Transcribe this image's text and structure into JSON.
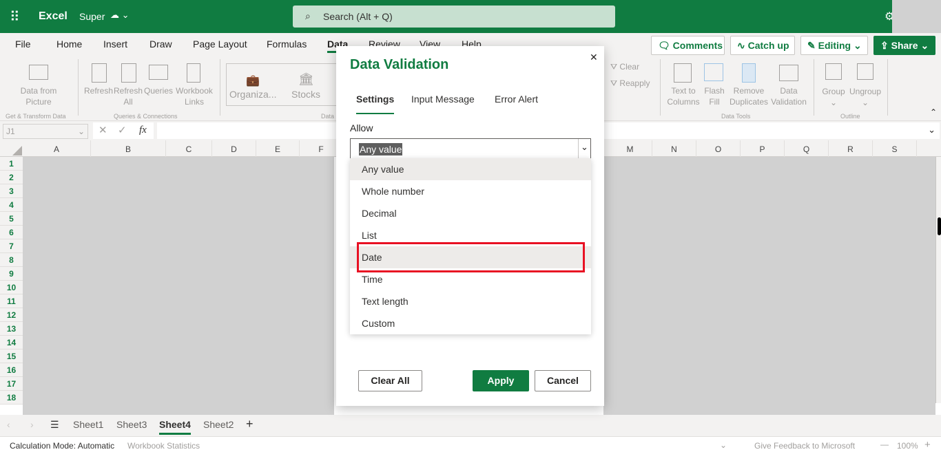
{
  "app": {
    "name": "Excel",
    "file": "Super",
    "search_placeholder": "Search (Alt + Q)"
  },
  "menu": [
    "File",
    "Home",
    "Insert",
    "Draw",
    "Page Layout",
    "Formulas",
    "Data",
    "Review",
    "View",
    "Help"
  ],
  "header_buttons": {
    "comments": "Comments",
    "catchup": "Catch up",
    "editing": "Editing",
    "share": "Share"
  },
  "ribbon": {
    "data_from_picture": [
      "Data from",
      "Picture"
    ],
    "get_transform": "Get & Transform Data",
    "refresh": "Refresh",
    "refresh_all": [
      "Refresh",
      "All"
    ],
    "queries": "Queries",
    "workbook_links": [
      "Workbook",
      "Links"
    ],
    "queries_connections": "Queries & Connections",
    "organization": "Organiza...",
    "stocks": "Stocks",
    "data_types": "Data",
    "clear": "Clear",
    "reapply": "Reapply",
    "text_to_columns": [
      "Text to",
      "Columns"
    ],
    "flash_fill": [
      "Flash",
      "Fill"
    ],
    "remove_duplicates": [
      "Remove",
      "Duplicates"
    ],
    "data_validation": [
      "Data",
      "Validation"
    ],
    "data_tools": "Data Tools",
    "group": "Group",
    "ungroup": "Ungroup",
    "outline": "Outline"
  },
  "formula_bar": {
    "name_box": "J1",
    "fx": "fx",
    "value": ""
  },
  "columns": [
    "A",
    "B",
    "C",
    "D",
    "E",
    "F",
    "M",
    "N",
    "O",
    "P",
    "Q",
    "R",
    "S"
  ],
  "rows": [
    "1",
    "2",
    "3",
    "4",
    "5",
    "6",
    "7",
    "8",
    "9",
    "10",
    "11",
    "12",
    "13",
    "14",
    "15",
    "16",
    "17",
    "18"
  ],
  "dialog": {
    "title": "Data Validation",
    "tabs": [
      "Settings",
      "Input Message",
      "Error Alert"
    ],
    "active_tab": "Settings",
    "allow_label": "Allow",
    "allow_value": "Any value",
    "options": [
      "Any value",
      "Whole number",
      "Decimal",
      "List",
      "Date",
      "Time",
      "Text length",
      "Custom"
    ],
    "highlighted_option": "Date",
    "clear_all": "Clear All",
    "apply": "Apply",
    "cancel": "Cancel"
  },
  "sheets": [
    "Sheet1",
    "Sheet3",
    "Sheet4",
    "Sheet2"
  ],
  "active_sheet": "Sheet4",
  "status": {
    "calc_mode": "Calculation Mode: Automatic",
    "workbook_stats": "Workbook Statistics",
    "feedback": "Give Feedback to Microsoft",
    "zoom": "100%"
  },
  "colors": {
    "brand": "#107c41",
    "highlight": "#e81123"
  }
}
